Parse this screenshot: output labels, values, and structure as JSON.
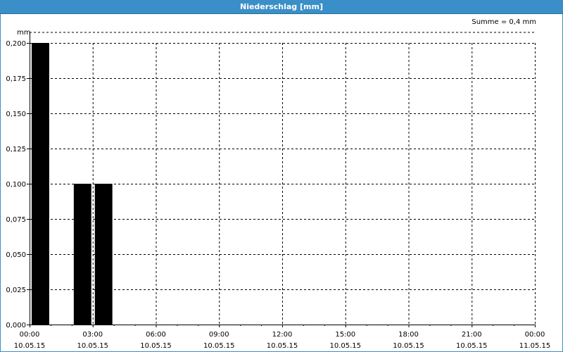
{
  "window": {
    "title": "Niederschlag [mm]"
  },
  "summary": "Summe = 0,4 mm",
  "colors": {
    "titlebar": "#3b8fc8",
    "bar": "#000000",
    "grid": "#000000"
  },
  "chart_data": {
    "type": "bar",
    "title": "Niederschlag [mm]",
    "ylabel": "mm",
    "xlabel": "",
    "ylim": [
      0,
      0.2
    ],
    "grid": true,
    "y_ticks": [
      "0,000",
      "0,025",
      "0,050",
      "0,075",
      "0,100",
      "0,125",
      "0,150",
      "0,175",
      "0,200"
    ],
    "x_ticks": [
      {
        "time": "00:00",
        "date": "10.05.15"
      },
      {
        "time": "03:00",
        "date": "10.05.15"
      },
      {
        "time": "06:00",
        "date": "10.05.15"
      },
      {
        "time": "09:00",
        "date": "10.05.15"
      },
      {
        "time": "12:00",
        "date": "10.05.15"
      },
      {
        "time": "15:00",
        "date": "10.05.15"
      },
      {
        "time": "18:00",
        "date": "10.05.15"
      },
      {
        "time": "21:00",
        "date": "10.05.15"
      },
      {
        "time": "00:00",
        "date": "11.05.15"
      }
    ],
    "x_range": [
      "10.05.15 00:00",
      "11.05.15 00:00"
    ],
    "bars": [
      {
        "start": "10.05.15 00:00",
        "end": "10.05.15 01:00",
        "value": 0.2
      },
      {
        "start": "10.05.15 02:00",
        "end": "10.05.15 03:00",
        "value": 0.1
      },
      {
        "start": "10.05.15 03:00",
        "end": "10.05.15 04:00",
        "value": 0.1
      }
    ]
  }
}
